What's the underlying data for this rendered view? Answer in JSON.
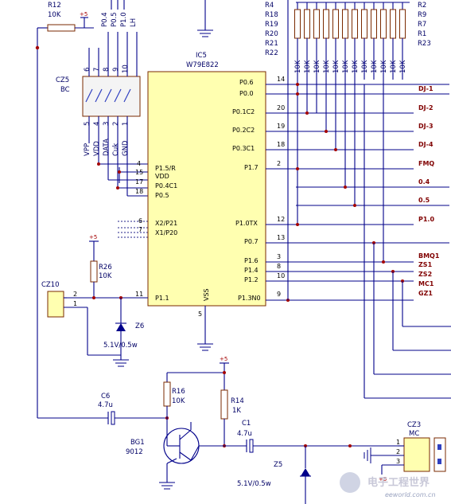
{
  "ic": {
    "ref": "IC5",
    "part": "W79E822",
    "left_pins": [
      {
        "num": "4",
        "name": "P1.5/R"
      },
      {
        "num": "15",
        "name": "VDD"
      },
      {
        "num": "17",
        "name": "P0.4C1"
      },
      {
        "num": "18",
        "name": "P0.5"
      },
      {
        "num": "6",
        "name": "X2/P21"
      },
      {
        "num": "7",
        "name": "X1/P20"
      },
      {
        "num": "11",
        "name": "P1.1"
      }
    ],
    "right_pins": [
      {
        "num": "14",
        "name": "P0.6"
      },
      {
        "num": "",
        "name": "P0.0"
      },
      {
        "num": "20",
        "name": "P0.1C2"
      },
      {
        "num": "19",
        "name": "P0.2C2"
      },
      {
        "num": "18",
        "name": "P0.3C1"
      },
      {
        "num": "2",
        "name": "P1.7"
      },
      {
        "num": "12",
        "name": "P1.0TX"
      },
      {
        "num": "13",
        "name": "P0.7"
      },
      {
        "num": "3",
        "name": "P1.6"
      },
      {
        "num": "8",
        "name": "P1.4"
      },
      {
        "num": "10",
        "name": "P1.2"
      },
      {
        "num": "9",
        "name": "P1.3N0"
      }
    ],
    "vss_label": "VSS",
    "vss_pin": "5"
  },
  "connector_cz5": {
    "ref": "CZ5",
    "value": "BC",
    "top_pins": [
      "6",
      "7",
      "8",
      "9",
      "10"
    ],
    "bottom_pins": [
      "5",
      "4",
      "3",
      "2",
      "1"
    ],
    "top_nets": [
      "P0.4",
      "P0.5",
      "P1.0",
      "LH"
    ],
    "bottom_nets": [
      "VPP",
      "VDD",
      "DATA",
      "Cuk",
      "GND"
    ]
  },
  "resistor_r12": {
    "ref": "R12",
    "value": "10K"
  },
  "resistor_r26": {
    "ref": "R26",
    "value": "10K"
  },
  "resistor_r16": {
    "ref": "R16",
    "value": "10K"
  },
  "resistor_r14": {
    "ref": "R14",
    "value": "1K"
  },
  "pullup_refs": [
    "R4",
    "R18",
    "R19",
    "R20",
    "R21",
    "R22"
  ],
  "pullup_refs_right": [
    "R2",
    "R9",
    "R7",
    "R1",
    "R23"
  ],
  "pullup_value": "10K",
  "cap_c6": {
    "ref": "C6",
    "value": "4.7u"
  },
  "cap_c1": {
    "ref": "C1",
    "value": "4.7u"
  },
  "transistor": {
    "ref": "BG1",
    "part": "9012"
  },
  "zener_z6": {
    "ref": "Z6",
    "value": "5.1V/0.5w"
  },
  "zener_z5": {
    "ref": "Z5",
    "value": "5.1V/0.5w"
  },
  "connector_cz10": {
    "ref": "CZ10",
    "pins": [
      "2",
      "1"
    ]
  },
  "connector_cz3": {
    "ref": "CZ3",
    "value": "MC",
    "pins": [
      "1",
      "2",
      "3"
    ]
  },
  "power_label": "+5",
  "net_labels": [
    "DJ-1",
    "DJ-2",
    "DJ-3",
    "DJ-4",
    "FMQ",
    "0.4",
    "0.5",
    "P1.0",
    "BMQ1",
    "ZS1",
    "ZS2",
    "MC1",
    "GZ1"
  ],
  "watermark": {
    "cn": "电子工程世界",
    "url": "eeworld.com.cn"
  }
}
